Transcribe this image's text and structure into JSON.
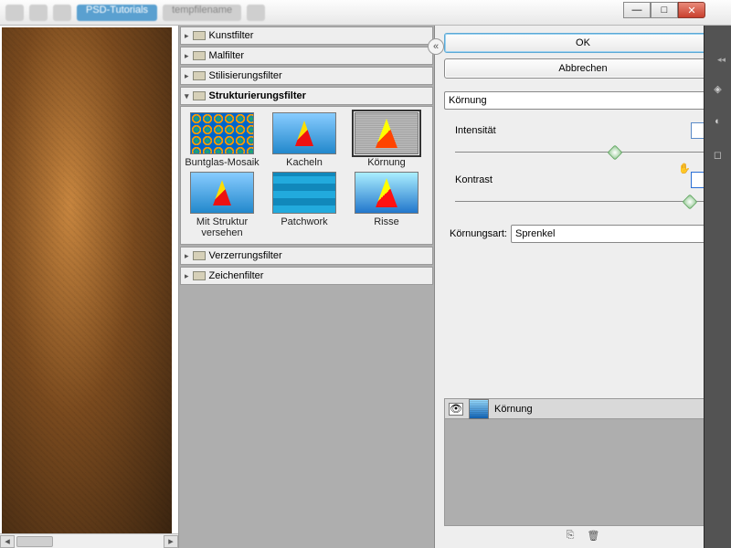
{
  "titlebar": {
    "tabs": [
      "",
      "",
      "",
      "PSD-Tutorials",
      "tempfilename",
      ""
    ]
  },
  "winctrl": {
    "min": "—",
    "max": "□",
    "close": "✕"
  },
  "categories": [
    {
      "label": "Kunstfilter",
      "open": false
    },
    {
      "label": "Malfilter",
      "open": false
    },
    {
      "label": "Stilisierungsfilter",
      "open": false
    },
    {
      "label": "Strukturierungsfilter",
      "open": true
    },
    {
      "label": "Verzerrungsfilter",
      "open": false
    },
    {
      "label": "Zeichenfilter",
      "open": false
    }
  ],
  "thumbs": [
    {
      "label": "Buntglas-Mosaik"
    },
    {
      "label": "Kacheln"
    },
    {
      "label": "Körnung",
      "selected": true
    },
    {
      "label": "Mit Struktur versehen"
    },
    {
      "label": "Patchwork"
    },
    {
      "label": "Risse"
    }
  ],
  "buttons": {
    "ok": "OK",
    "cancel": "Abbrechen"
  },
  "filterSelect": "Körnung",
  "params": {
    "intensity": {
      "label": "Intensität",
      "value": "55",
      "pos": 60
    },
    "contrast": {
      "label": "Kontrast",
      "value": "80",
      "pos": 88
    }
  },
  "grainType": {
    "label": "Körnungsart:",
    "value": "Sprenkel"
  },
  "layer": {
    "name": "Körnung"
  },
  "collapse": "«"
}
